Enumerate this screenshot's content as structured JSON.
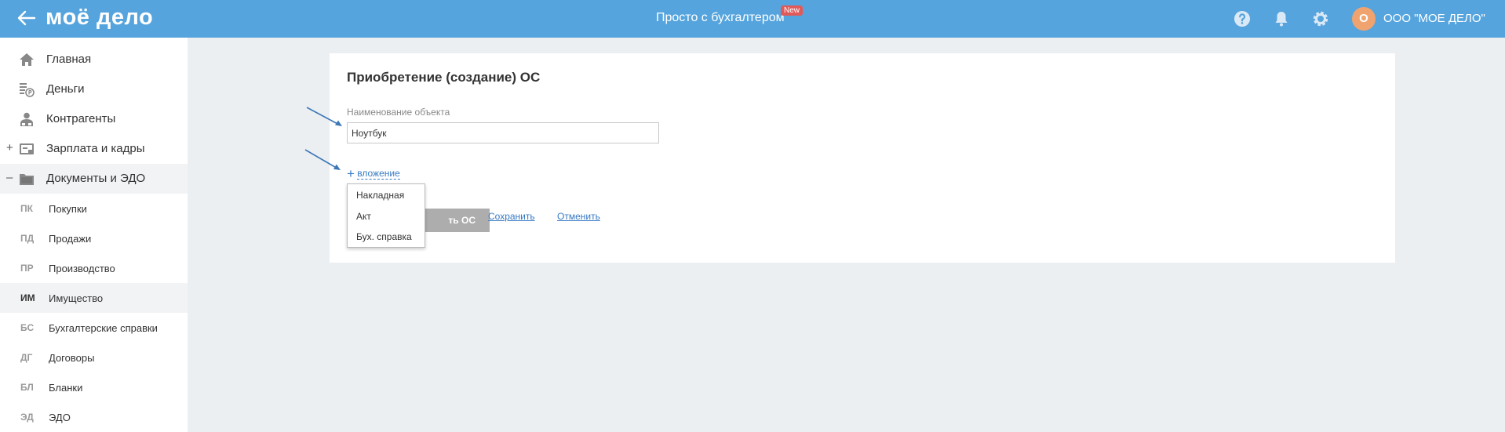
{
  "header": {
    "logo": "моё дело",
    "promo": "Просто с бухгалтером",
    "promo_badge": "New",
    "avatar_initial": "О",
    "company": "ООО \"МОЕ ДЕЛО\"",
    "icons": [
      "back-arrow-icon",
      "help-icon",
      "bell-icon",
      "gear-icon"
    ],
    "colors": {
      "bar": "#55a4dd",
      "badge": "#e05a5a",
      "avatar": "#f0a36e"
    }
  },
  "sidebar": {
    "main": [
      {
        "label": "Главная",
        "icon": "home-icon"
      },
      {
        "label": "Деньги",
        "icon": "money-icon"
      },
      {
        "label": "Контрагенты",
        "icon": "contractors-icon"
      },
      {
        "label": "Зарплата и кадры",
        "icon": "salary-icon",
        "toggle": "+"
      },
      {
        "label": "Документы и ЭДО",
        "icon": "folder-icon",
        "toggle": "–"
      }
    ],
    "sub": [
      {
        "abbr": "ПК",
        "label": "Покупки"
      },
      {
        "abbr": "ПД",
        "label": "Продажи"
      },
      {
        "abbr": "ПР",
        "label": "Производство"
      },
      {
        "abbr": "ИМ",
        "label": "Имущество"
      },
      {
        "abbr": "БС",
        "label": "Бухгалтерские справки"
      },
      {
        "abbr": "ДГ",
        "label": "Договоры"
      },
      {
        "abbr": "БЛ",
        "label": "Бланки"
      },
      {
        "abbr": "ЭД",
        "label": "ЭДО"
      }
    ]
  },
  "form": {
    "title": "Приобретение (создание) ОС",
    "name_label": "Наименование объекта",
    "name_value": "Ноутбук",
    "attach_plus": "+",
    "attach_label": "вложение",
    "dropdown": [
      "Накладная",
      "Акт",
      "Бух. справка"
    ],
    "create_button": "ть ОС",
    "save_link": "Сохранить",
    "cancel_link": "Отменить"
  }
}
